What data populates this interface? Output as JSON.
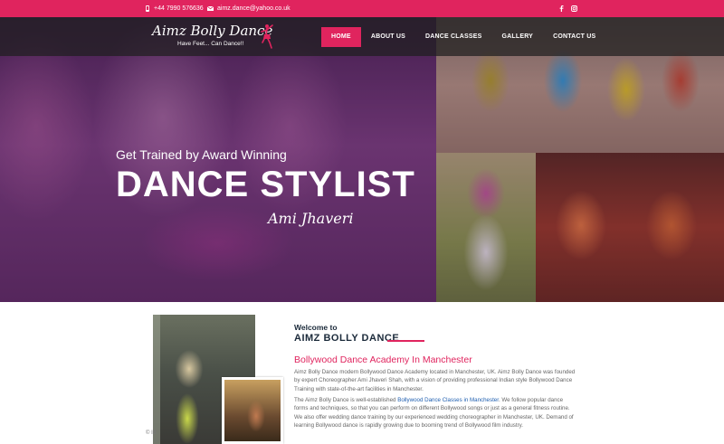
{
  "topbar": {
    "phone": "+44 7990 576636",
    "email": "aimz.dance@yahoo.co.uk",
    "bg_color": "#e0245e",
    "icons": [
      "phone-icon",
      "mail-icon",
      "facebook-icon",
      "instagram-icon"
    ]
  },
  "header": {
    "logo_name": "Aimz Bolly Dance",
    "logo_tagline": "Have Feet... Can Dance!!",
    "menu": [
      {
        "label": "HOME",
        "active": true
      },
      {
        "label": "ABOUT US",
        "active": false
      },
      {
        "label": "DANCE CLASSES",
        "active": false
      },
      {
        "label": "GALLERY",
        "active": false
      },
      {
        "label": "CONTACT US",
        "active": false
      }
    ]
  },
  "hero": {
    "subtitle": "Get Trained by Award Winning",
    "title": "DANCE STYLIST",
    "name": "Ami Jhaveri"
  },
  "welcome": {
    "small_heading": "Welcome to",
    "big_heading": "AIMZ BOLLY DANCE",
    "subheading": "Bollywood Dance Academy In Manchester",
    "para1": "Aimz Bolly Dance modern Bollywood Dance Academy located in Manchester, UK. Aimz Bolly Dance was founded by expert Choreographer Ami Jhaveri Shah, with a vision of providing professional Indian style Bollywood Dance Training with state-of-the-art facilities in Manchester.",
    "para2_before": "The Aimz Bolly Dance is well-established ",
    "para2_link": "Bollywood Dance Classes in Manchester",
    "para2_after": ". We follow popular dance forms and techniques, so that you can perform on different Bollywood songs or just as a general fitness routine. We also offer wedding dance training by our experienced wedding choreographer in Manchester, UK. Demand of learning Bollywood dance is rapidly growing due to booming trend of Bollywood film industry.",
    "photo_caption": "© IB",
    "accent_color": "#e0245e"
  }
}
